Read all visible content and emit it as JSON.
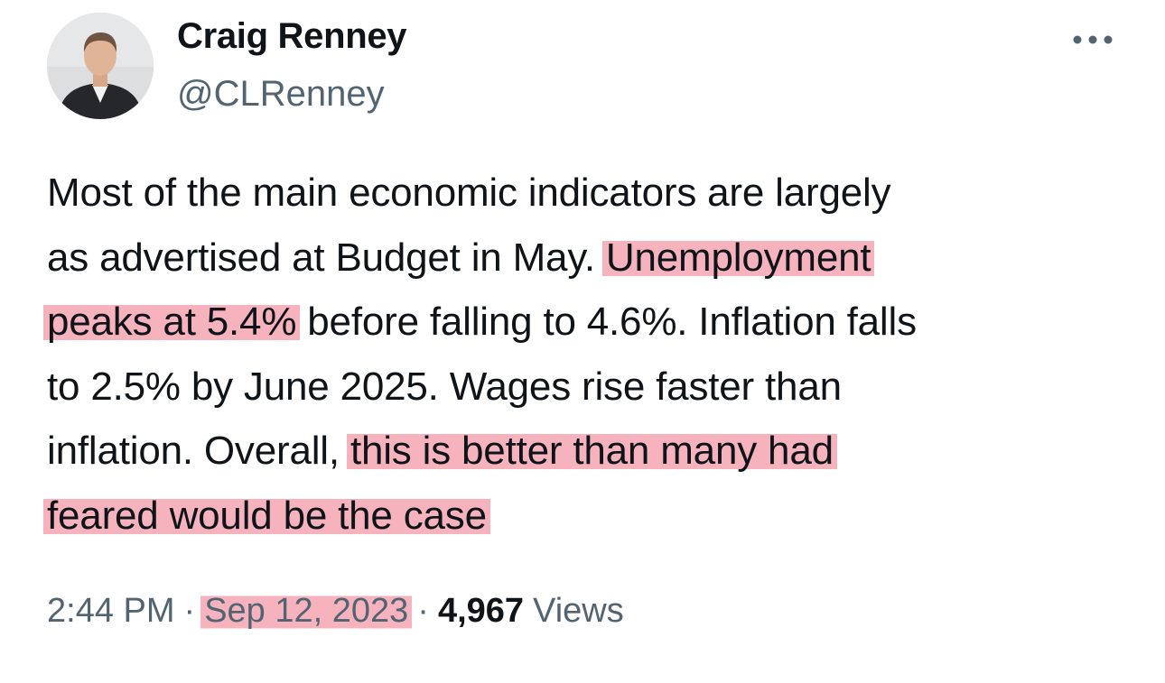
{
  "author": {
    "display_name": "Craig Renney",
    "handle": "@CLRenney",
    "avatar_icon": "person-avatar"
  },
  "menu": {
    "more_icon": "more-horizontal-icon"
  },
  "tweet": {
    "lines": [
      [
        {
          "text": "Most of the main economic indicators are largely",
          "highlight": false
        }
      ],
      [
        {
          "text": "as advertised at Budget in May. ",
          "highlight": false
        },
        {
          "text": "Unemployment",
          "highlight": true
        }
      ],
      [
        {
          "text": "peaks at 5.4%",
          "highlight": true
        },
        {
          "text": " before falling to 4.6%. Inflation falls",
          "highlight": false
        }
      ],
      [
        {
          "text": "to 2.5% by June 2025. Wages rise faster than",
          "highlight": false
        }
      ],
      [
        {
          "text": "inflation. Overall, ",
          "highlight": false
        },
        {
          "text": "this is better than many had",
          "highlight": true
        }
      ],
      [
        {
          "text": "feared would be the case",
          "highlight": true
        }
      ]
    ],
    "highlight_color": "#f396a5"
  },
  "meta": {
    "time": "2:44 PM",
    "separator": "·",
    "date": "Sep 12, 2023",
    "views_count": "4,967",
    "views_label": "Views"
  },
  "colors": {
    "text_primary": "#0f1419",
    "text_secondary": "#536471"
  }
}
